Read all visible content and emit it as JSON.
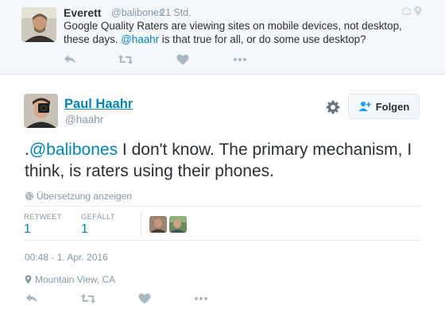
{
  "parent_tweet": {
    "name": "Everett",
    "handle": "@balibones",
    "separator": "·",
    "time": "21 Std.",
    "text_before": "Google Quality Raters are viewing sites on mobile devices, not desktop, these days. ",
    "mention": "@haahr",
    "text_after": " is that true for all, or do some use desktop?",
    "actions": [
      "reply-icon",
      "retweet-icon",
      "heart-icon",
      "more-icon"
    ]
  },
  "main_tweet": {
    "name": "Paul Haahr",
    "handle": "@haahr",
    "follow_label": "Folgen",
    "text_prefix": ".",
    "mention": "@balibones",
    "text_body": " I don't know. The primary mechanism, I think, is raters using their phones.",
    "translate_label": "Übersetzung anzeigen",
    "stats": {
      "retweets_label": "RETWEET",
      "retweets_count": "1",
      "likes_label": "GEFÄLLT",
      "likes_count": "1"
    },
    "timestamp": "00:48 - 1. Apr. 2016",
    "location": "Mountain View, CA",
    "actions": [
      "reply-icon",
      "retweet-icon",
      "heart-icon",
      "more-icon"
    ]
  },
  "colors": {
    "link": "#0084b4",
    "text": "#292f33",
    "muted": "#8899a6",
    "parent_bg": "#f5f8fa",
    "border": "#e1e8ed",
    "icon": "#aab8c2"
  }
}
